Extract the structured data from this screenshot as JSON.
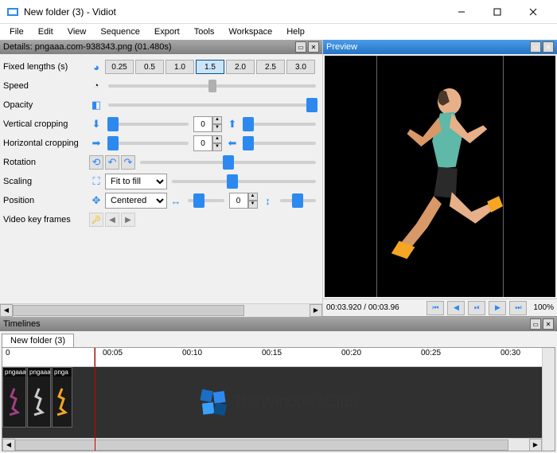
{
  "window": {
    "title": "New folder (3) - Vidiot"
  },
  "menu": [
    "File",
    "Edit",
    "View",
    "Sequence",
    "Export",
    "Tools",
    "Workspace",
    "Help"
  ],
  "details": {
    "panel_title": "Details: pngaaa.com-938343.png (01.480s)",
    "rows": {
      "fixed_lengths": {
        "label": "Fixed lengths (s)",
        "options": [
          "0.25",
          "0.5",
          "1.0",
          "1.5",
          "2.0",
          "2.5",
          "3.0"
        ],
        "active": "1.5"
      },
      "speed": {
        "label": "Speed"
      },
      "opacity": {
        "label": "Opacity"
      },
      "vcrop": {
        "label": "Vertical cropping",
        "value": "0"
      },
      "hcrop": {
        "label": "Horizontal cropping",
        "value": "0"
      },
      "rotation": {
        "label": "Rotation"
      },
      "scaling": {
        "label": "Scaling",
        "combo": "Fit to fill"
      },
      "position": {
        "label": "Position",
        "combo": "Centered",
        "value": "0"
      },
      "keyframes": {
        "label": "Video key frames"
      }
    }
  },
  "preview": {
    "panel_title": "Preview",
    "time": "00:03.920 / 00:03.96",
    "zoom": "100%"
  },
  "timelines": {
    "panel_title": "Timelines",
    "tab": "New folder (3)",
    "ruler_start": "0",
    "marks": [
      "00:05",
      "00:10",
      "00:15",
      "00:20",
      "00:25",
      "00:30"
    ],
    "clips": [
      "pngaaa",
      "pngaaa",
      "pnga"
    ]
  },
  "watermark": "TheWindowsClub",
  "colors": {
    "accent": "#2d89ef",
    "panel_blue": "#2574c7"
  }
}
